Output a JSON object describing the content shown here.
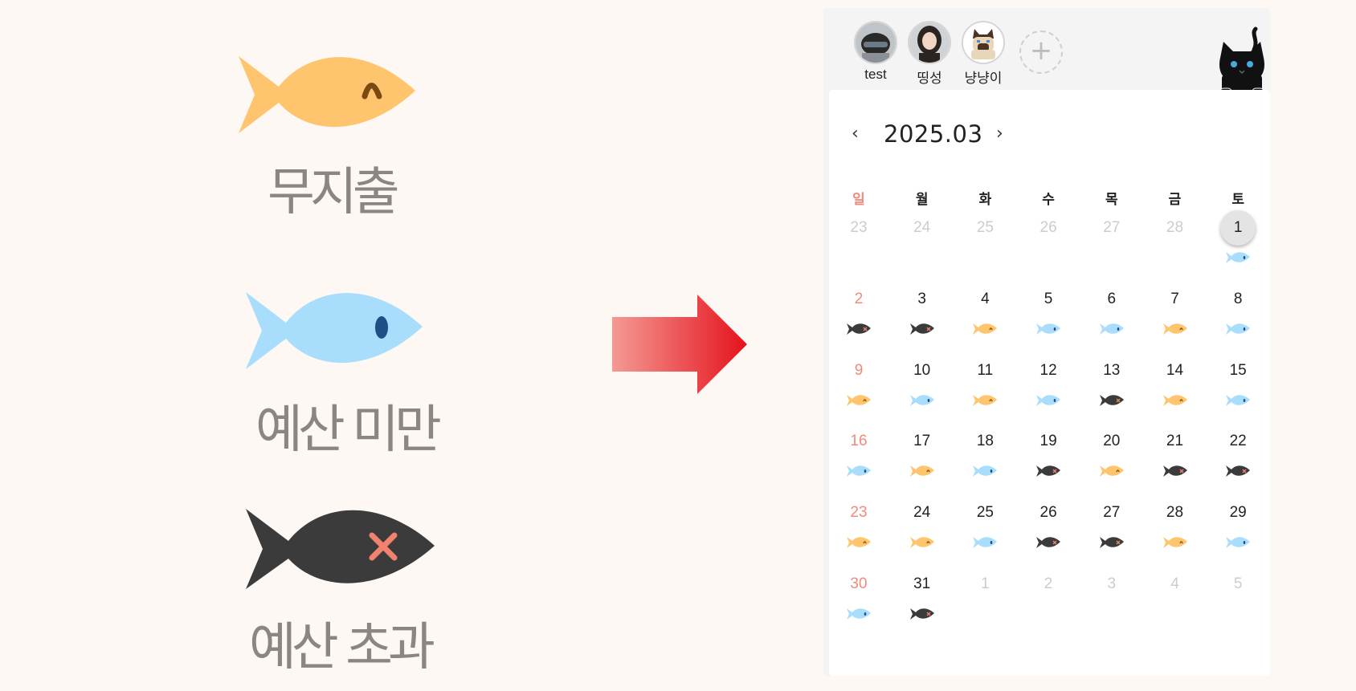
{
  "legend": [
    {
      "label": "무지출",
      "fish": "yellow"
    },
    {
      "label": "예산 미만",
      "fish": "blue"
    },
    {
      "label": "예산 초과",
      "fish": "black"
    }
  ],
  "colors": {
    "yellow_fish": "#ffc56e",
    "blue_fish": "#a8ddfb",
    "black_fish": "#3b3b3b",
    "arrow_start": "#f49a93",
    "arrow_end": "#e5121d",
    "sunday": "#f08a7e"
  },
  "profiles": [
    {
      "name": "test",
      "avatar": "helmet-avatar"
    },
    {
      "name": "띵성",
      "avatar": "person-avatar"
    },
    {
      "name": "냥냥이",
      "avatar": "siamese-cat-avatar"
    }
  ],
  "add_profile_icon": "plus-icon",
  "calendar": {
    "month": "2025.03",
    "prev_icon": "‹",
    "next_icon": "›",
    "weekdays": [
      "일",
      "월",
      "화",
      "수",
      "목",
      "금",
      "토"
    ],
    "weeks": [
      [
        {
          "d": "23",
          "m": true
        },
        {
          "d": "24",
          "m": true
        },
        {
          "d": "25",
          "m": true
        },
        {
          "d": "26",
          "m": true
        },
        {
          "d": "27",
          "m": true
        },
        {
          "d": "28",
          "m": true
        },
        {
          "d": "1",
          "f": "blue",
          "sel": true
        }
      ],
      [
        {
          "d": "2",
          "f": "black"
        },
        {
          "d": "3",
          "f": "black"
        },
        {
          "d": "4",
          "f": "yellow"
        },
        {
          "d": "5",
          "f": "blue"
        },
        {
          "d": "6",
          "f": "blue"
        },
        {
          "d": "7",
          "f": "yellow"
        },
        {
          "d": "8",
          "f": "blue"
        }
      ],
      [
        {
          "d": "9",
          "f": "yellow"
        },
        {
          "d": "10",
          "f": "blue"
        },
        {
          "d": "11",
          "f": "yellow"
        },
        {
          "d": "12",
          "f": "blue"
        },
        {
          "d": "13",
          "f": "black"
        },
        {
          "d": "14",
          "f": "yellow"
        },
        {
          "d": "15",
          "f": "blue"
        }
      ],
      [
        {
          "d": "16",
          "f": "blue"
        },
        {
          "d": "17",
          "f": "yellow"
        },
        {
          "d": "18",
          "f": "blue"
        },
        {
          "d": "19",
          "f": "black"
        },
        {
          "d": "20",
          "f": "yellow"
        },
        {
          "d": "21",
          "f": "black"
        },
        {
          "d": "22",
          "f": "black"
        }
      ],
      [
        {
          "d": "23",
          "f": "yellow"
        },
        {
          "d": "24",
          "f": "yellow"
        },
        {
          "d": "25",
          "f": "blue"
        },
        {
          "d": "26",
          "f": "black"
        },
        {
          "d": "27",
          "f": "black"
        },
        {
          "d": "28",
          "f": "yellow"
        },
        {
          "d": "29",
          "f": "blue"
        }
      ],
      [
        {
          "d": "30",
          "f": "blue"
        },
        {
          "d": "31",
          "f": "black"
        },
        {
          "d": "1",
          "m": true
        },
        {
          "d": "2",
          "m": true
        },
        {
          "d": "3",
          "m": true
        },
        {
          "d": "4",
          "m": true
        },
        {
          "d": "5",
          "m": true
        }
      ]
    ]
  }
}
